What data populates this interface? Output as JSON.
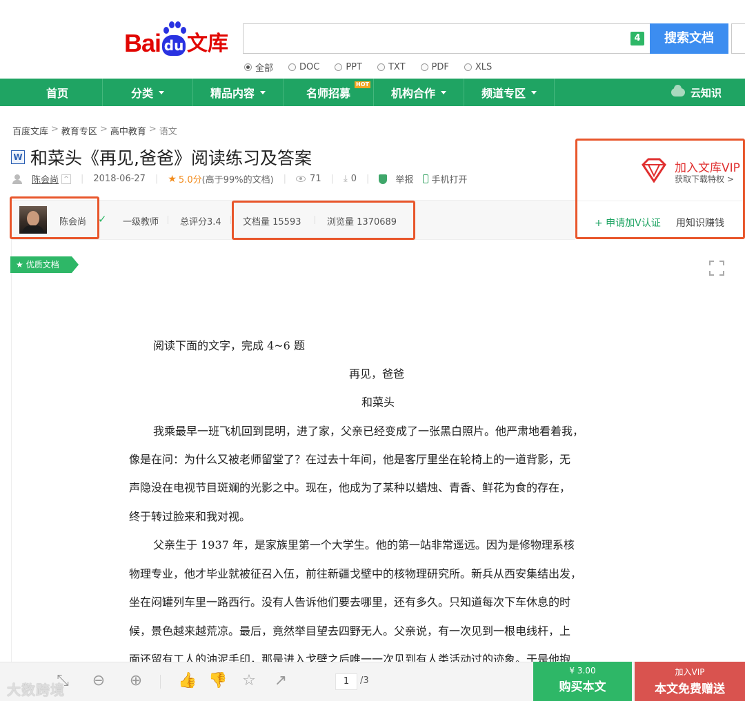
{
  "header": {
    "logo_bai": "Bai",
    "logo_du": "du",
    "logo_wenku": "文库",
    "search_badge": "4",
    "search_button": "搜索文档",
    "file_types": [
      {
        "label": "全部",
        "selected": true
      },
      {
        "label": "DOC",
        "selected": false
      },
      {
        "label": "PPT",
        "selected": false
      },
      {
        "label": "TXT",
        "selected": false
      },
      {
        "label": "PDF",
        "selected": false
      },
      {
        "label": "XLS",
        "selected": false
      }
    ]
  },
  "nav": {
    "items": [
      {
        "label": "首页",
        "dropdown": false
      },
      {
        "label": "分类",
        "dropdown": true
      },
      {
        "label": "精品内容",
        "dropdown": true
      },
      {
        "label": "名师招募",
        "dropdown": false,
        "badge": "HOT"
      },
      {
        "label": "机构合作",
        "dropdown": true
      },
      {
        "label": "频道专区",
        "dropdown": true
      }
    ],
    "right_label": "云知识"
  },
  "breadcrumb": [
    "百度文库",
    "教育专区",
    "高中教育",
    "语文"
  ],
  "document": {
    "type_icon": "W",
    "title": "和菜头《再见,爸爸》阅读练习及答案",
    "author": "陈会尚",
    "date": "2018-06-27",
    "rating": "5.0分",
    "rating_note": "(高于99%的文档)",
    "views": "71",
    "downloads": "0",
    "report": "举报",
    "mobile_open": "手机打开"
  },
  "author_strip": {
    "name": "陈会尚",
    "level": "一级教师",
    "total_score": "总评分3.4",
    "doc_count": "文档量 15593",
    "view_count": "浏览量 1370689"
  },
  "vip_panel": {
    "join": "加入文库VIP",
    "sub": "获取下载特权 >",
    "apply": "+ 申请加V认证",
    "earn": "用知识赚钱"
  },
  "quality_tag": "优质文档",
  "content_lines": [
    "阅读下面的文字，完成 4~6 题",
    "再见，爸爸",
    "和菜头",
    "我乘最早一班飞机回到昆明，进了家，父亲已经变成了一张黑白照片。他严肃地看着我，",
    "像是在问：为什么又被老师留堂了？在过去十年间，他是客厅里坐在轮椅上的一道背影，无",
    "声隐没在电视节目斑斓的光影之中。现在，他成为了某种以蜡烛、青香、鲜花为食的存在，",
    "终于转过脸来和我对视。",
    "父亲生于 1937 年，是家族里第一个大学生。他的第一站非常遥远。因为是修物理系核",
    "物理专业，他才毕业就被征召入伍，前往新疆戈壁中的核物理研究所。新兵从西安集结出发，",
    "坐在闷罐列车里一路西行。没有人告诉他们要去哪里，还有多久。只知道每次下车休息的时",
    "候，景色越来越荒凉。最后，竟然举目望去四野无人。父亲说，有一次见到一根电线杆，上",
    "面还留有工人的油泥手印，那是进入戈壁之后唯一一次见到有人类活动过的迹象。于是他抱"
  ],
  "toolbar": {
    "page_current": "1",
    "page_total": "/3",
    "watermark": "大数跨境"
  },
  "buy": {
    "price": "¥ 3.00",
    "label": "购买本文"
  },
  "vip_buy": {
    "top": "加入VIP",
    "label": "本文免费赠送"
  },
  "colors": {
    "brand_green": "#1fa463",
    "search_blue": "#3c8df0",
    "highlight_red": "#e8562b",
    "vip_red": "#d9534f"
  }
}
